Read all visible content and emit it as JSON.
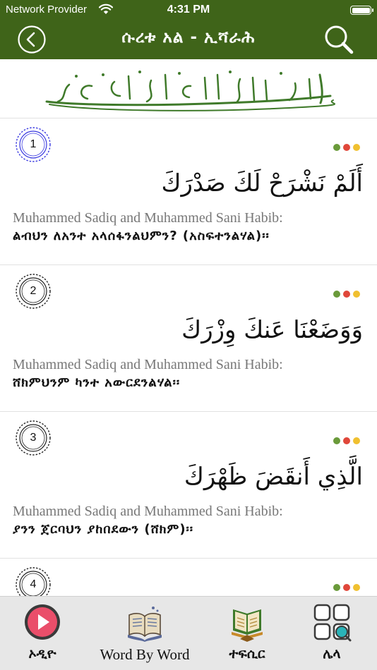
{
  "status_bar": {
    "carrier": "Network Provider",
    "time": "4:31 PM"
  },
  "nav": {
    "title": "ሱረቱ አል - ኢሻራሕ"
  },
  "colors": {
    "primary": "#3f6419",
    "dot_green": "#6a9a3a",
    "dot_red": "#e0473a",
    "dot_yellow": "#f0c030",
    "badge_blue": "#3a3ae0"
  },
  "verses": [
    {
      "number": "1",
      "arabic": "أَلَمْ نَشْرَحْ لَكَ صَدْرَكَ",
      "translator": "Muhammed Sadiq and Muhammed Sani Habib:",
      "translation": "ልብህን ለአንተ አላሰፋንልህምን? (አስፍተንልሃል)፡፡"
    },
    {
      "number": "2",
      "arabic": "وَوَضَعْنَا عَنكَ وِزْرَكَ",
      "translator": "Muhammed Sadiq and Muhammed Sani Habib:",
      "translation": "ሸክምህንም ካንተ አውርደንልሃል፡፡"
    },
    {
      "number": "3",
      "arabic": "الَّذِي أَنقَضَ ظَهْرَكَ",
      "translator": "Muhammed Sadiq and Muhammed Sani Habib:",
      "translation": "ያንን ጀርባህን ያከበደውን (ሸክም)፡፡"
    },
    {
      "number": "4"
    }
  ],
  "tabs": [
    {
      "label": "ኦዲዮ",
      "icon": "play-icon"
    },
    {
      "label": "Word By Word",
      "icon": "book-icon"
    },
    {
      "label": "ተፍሲር",
      "icon": "quran-icon"
    },
    {
      "label": "ሌላ",
      "icon": "grid-icon"
    }
  ]
}
